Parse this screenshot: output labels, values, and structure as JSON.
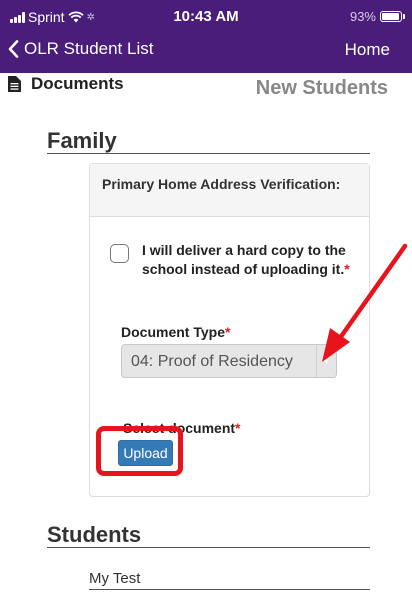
{
  "status_bar": {
    "carrier": "Sprint",
    "time": "10:43 AM",
    "battery": "93%"
  },
  "nav": {
    "back_label": "OLR Student List",
    "home_label": "Home"
  },
  "header": {
    "documents_label": "Documents",
    "new_students_label": "New Students"
  },
  "family": {
    "title": "Family",
    "card_title": "Primary Home Address Verification:",
    "checkbox_label": "I will deliver a hard copy to the school instead of uploading it.",
    "required_mark": "*",
    "doc_type_label": "Document Type",
    "doc_type_value": "04: Proof of Residency",
    "select_doc_label": "Select document",
    "upload_label": "Upload"
  },
  "students": {
    "title": "Students",
    "items": [
      {
        "name": "My Test"
      }
    ]
  },
  "colors": {
    "nav_bg": "#4a1d7a",
    "upload_bg": "#337ab7",
    "annotation": "#e8141b",
    "required": "#e02020"
  }
}
